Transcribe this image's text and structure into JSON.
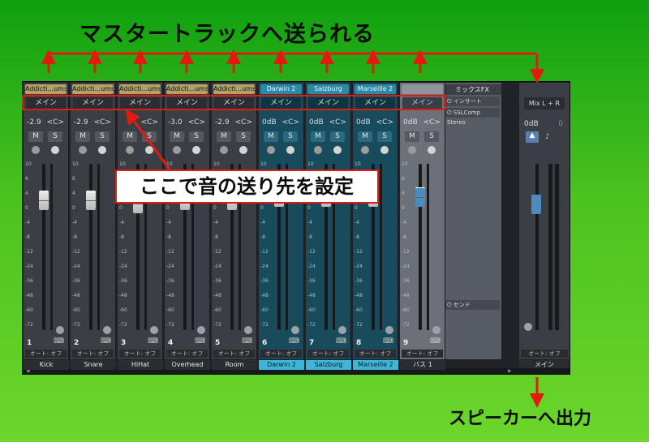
{
  "annotations": {
    "heading": "マスタートラックへ送られる",
    "callout": "ここで音の送り先を設定",
    "footer": "スピーカーへ出力"
  },
  "channels": [
    {
      "label": "Addicti...ums2",
      "dest": "メイン",
      "vol": "-2.9",
      "pan": "<C>",
      "num": "1",
      "name": "Kick",
      "teal": false,
      "fader": 0.78
    },
    {
      "label": "Addicti...ums2",
      "dest": "メイン",
      "vol": "-2.9",
      "pan": "<C>",
      "num": "2",
      "name": "Snare",
      "teal": false,
      "fader": 0.78
    },
    {
      "label": "Addicti...ums2",
      "dest": "メイン",
      "vol": "",
      "pan": "<C>",
      "num": "3",
      "name": "HiHat",
      "teal": false,
      "fader": 0.76
    },
    {
      "label": "Addicti...ums2",
      "dest": "メイン",
      "vol": "-3.0",
      "pan": "<C>",
      "num": "4",
      "name": "Overhead",
      "teal": false,
      "fader": 0.78
    },
    {
      "label": "Addicti...ums2",
      "dest": "メイン",
      "vol": "-2.9",
      "pan": "<C>",
      "num": "5",
      "name": "Room",
      "teal": false,
      "fader": 0.78
    },
    {
      "label": "Darwin 2",
      "dest": "メイン",
      "vol": "0dB",
      "pan": "<C>",
      "num": "6",
      "name": "Darwin 2",
      "teal": true,
      "fader": 0.8
    },
    {
      "label": "Salzburg",
      "dest": "メイン",
      "vol": "0dB",
      "pan": "<C>",
      "num": "7",
      "name": "Salzburg",
      "teal": true,
      "fader": 0.8
    },
    {
      "label": "Marseille 2",
      "dest": "メイン",
      "vol": "0dB",
      "pan": "<C>",
      "num": "8",
      "name": "Marseille 2",
      "teal": true,
      "fader": 0.8
    }
  ],
  "bus": {
    "label": "",
    "dest": "メイン",
    "vol": "0dB",
    "pan": "<C>",
    "num": "9",
    "name": "バス 1",
    "fader": 0.8
  },
  "common": {
    "mute": "M",
    "solo": "S",
    "auto": "オート: オフ"
  },
  "scale_marks": [
    "10",
    "6",
    "4",
    "0",
    "-4",
    "-8",
    "-12",
    "-24",
    "-36",
    "-48",
    "-60",
    "-72"
  ],
  "fx": {
    "title": "ミックスFX",
    "insert": "インサート",
    "plugin": "SSLComp Stereo",
    "send": "センド"
  },
  "main": {
    "dest": "Mix L + R",
    "vol": "0dB",
    "vol2": "0",
    "name": "メイン"
  },
  "colors": {
    "arrow": "#e01c10",
    "teal": "#3fb5d5"
  }
}
